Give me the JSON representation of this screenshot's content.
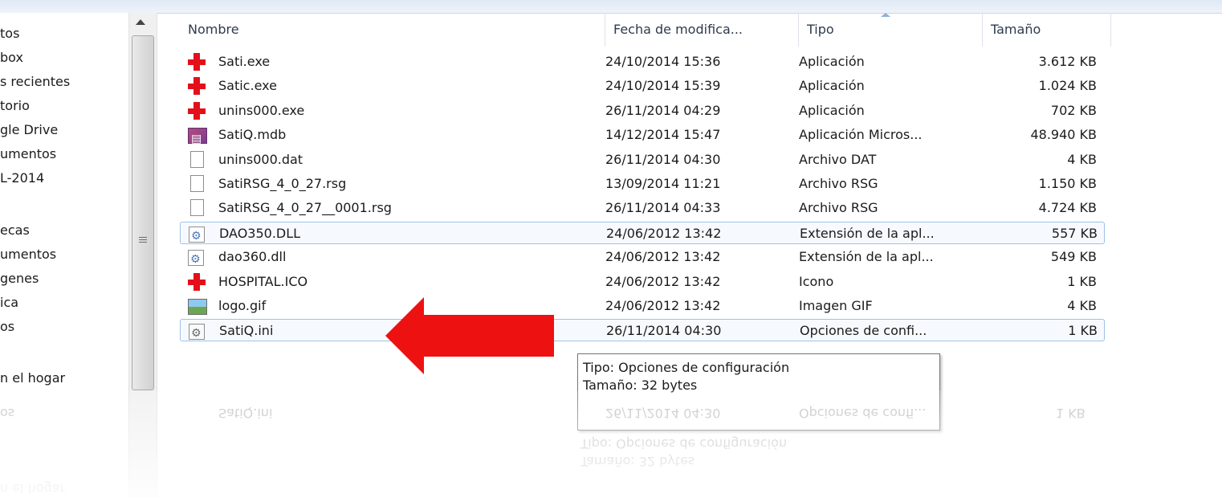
{
  "nav": {
    "items": [
      "tos",
      "box",
      "s recientes",
      "torio",
      "gle Drive",
      "umentos",
      "L-2014",
      "",
      "ecas",
      "umentos",
      "genes",
      "ica",
      "os",
      "",
      "n el hogar"
    ]
  },
  "columns": {
    "name": "Nombre",
    "date": "Fecha de modifica...",
    "type": "Tipo",
    "size": "Tamaño"
  },
  "files": [
    {
      "name": "Sati.exe",
      "date": "24/10/2014 15:36",
      "type": "Aplicación",
      "size": "3.612 KB",
      "icon": "red-cross-icon"
    },
    {
      "name": "Satic.exe",
      "date": "24/10/2014 15:39",
      "type": "Aplicación",
      "size": "1.024 KB",
      "icon": "red-cross-icon"
    },
    {
      "name": "unins000.exe",
      "date": "26/11/2014 04:29",
      "type": "Aplicación",
      "size": "702 KB",
      "icon": "red-cross-icon"
    },
    {
      "name": "SatiQ.mdb",
      "date": "14/12/2014 15:47",
      "type": "Aplicación Micros...",
      "size": "48.940 KB",
      "icon": "access-database-icon"
    },
    {
      "name": "unins000.dat",
      "date": "26/11/2014 04:30",
      "type": "Archivo DAT",
      "size": "4 KB",
      "icon": "document-icon"
    },
    {
      "name": "SatiRSG_4_0_27.rsg",
      "date": "13/09/2014 11:21",
      "type": "Archivo RSG",
      "size": "1.150 KB",
      "icon": "document-icon"
    },
    {
      "name": "SatiRSG_4_0_27__0001.rsg",
      "date": "26/11/2014 04:33",
      "type": "Archivo RSG",
      "size": "4.724 KB",
      "icon": "document-icon"
    },
    {
      "name": "DAO350.DLL",
      "date": "24/06/2012 13:42",
      "type": "Extensión de la apl...",
      "size": "557 KB",
      "icon": "dll-gear-icon",
      "selected": true
    },
    {
      "name": "dao360.dll",
      "date": "24/06/2012 13:42",
      "type": "Extensión de la apl...",
      "size": "549 KB",
      "icon": "dll-gear-icon"
    },
    {
      "name": "HOSPITAL.ICO",
      "date": "24/06/2012 13:42",
      "type": "Icono",
      "size": "1 KB",
      "icon": "red-cross-icon"
    },
    {
      "name": "logo.gif",
      "date": "24/06/2012 13:42",
      "type": "Imagen GIF",
      "size": "4 KB",
      "icon": "image-icon"
    },
    {
      "name": "SatiQ.ini",
      "date": "26/11/2014 04:30",
      "type": "Opciones de confi...",
      "size": "1 KB",
      "icon": "ini-settings-icon",
      "selected": true
    }
  ],
  "tooltip": {
    "type_line": "Tipo: Opciones de configuración",
    "size_line": "Tamaño: 32 bytes"
  },
  "colors": {
    "arrow": "#ee1111",
    "selection_border": "#9fc1e6",
    "red_cross": "#e3101a"
  }
}
